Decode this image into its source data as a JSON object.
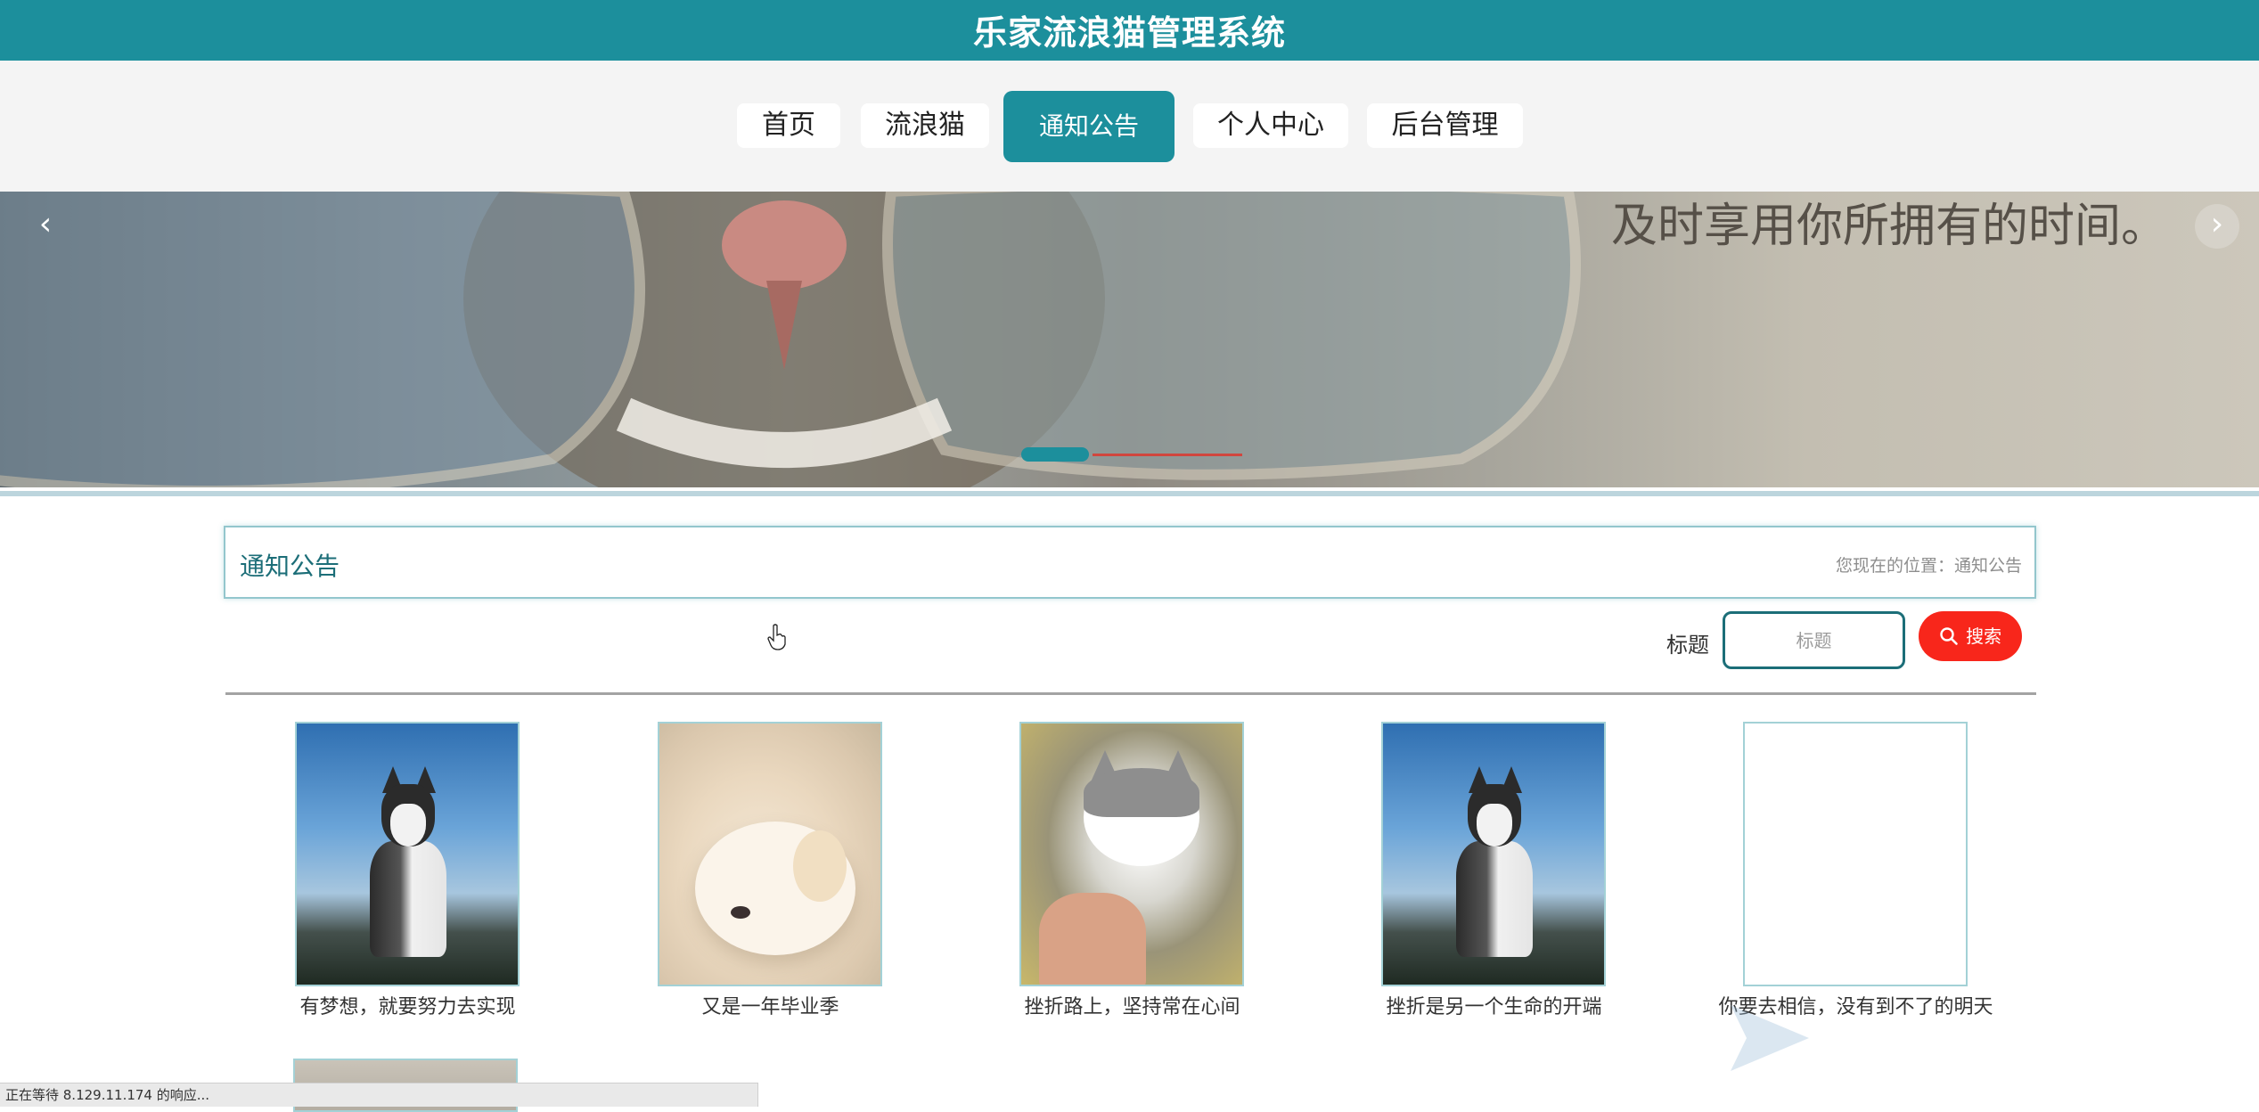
{
  "header": {
    "site_title": "乐家流浪猫管理系统",
    "brand_color": "#1c8f9c"
  },
  "nav": {
    "items": [
      {
        "label": "首页",
        "active": false
      },
      {
        "label": "流浪猫",
        "active": false
      },
      {
        "label": "通知公告",
        "active": true
      },
      {
        "label": "个人中心",
        "active": false
      },
      {
        "label": "后台管理",
        "active": false
      }
    ]
  },
  "banner": {
    "quote": "及时享用你所拥有的时间。",
    "prev_icon": "chevron-left-icon",
    "next_icon": "chevron-right-icon"
  },
  "breadcrumb": {
    "title": "通知公告",
    "location": "您现在的位置：通知公告"
  },
  "search": {
    "label": "标题",
    "placeholder": "标题",
    "button_label": "搜索",
    "button_color": "#f8261b"
  },
  "notices": [
    {
      "title": "有梦想，就要努力去实现",
      "image": "husky"
    },
    {
      "title": "又是一年毕业季",
      "image": "puppy"
    },
    {
      "title": "挫折路上，坚持常在心间",
      "image": "cat"
    },
    {
      "title": "挫折是另一个生命的开端",
      "image": "husky"
    },
    {
      "title": "你要去相信，没有到不了的明天",
      "image": "blank"
    }
  ],
  "status_bar": {
    "text": "正在等待 8.129.11.174 的响应..."
  }
}
